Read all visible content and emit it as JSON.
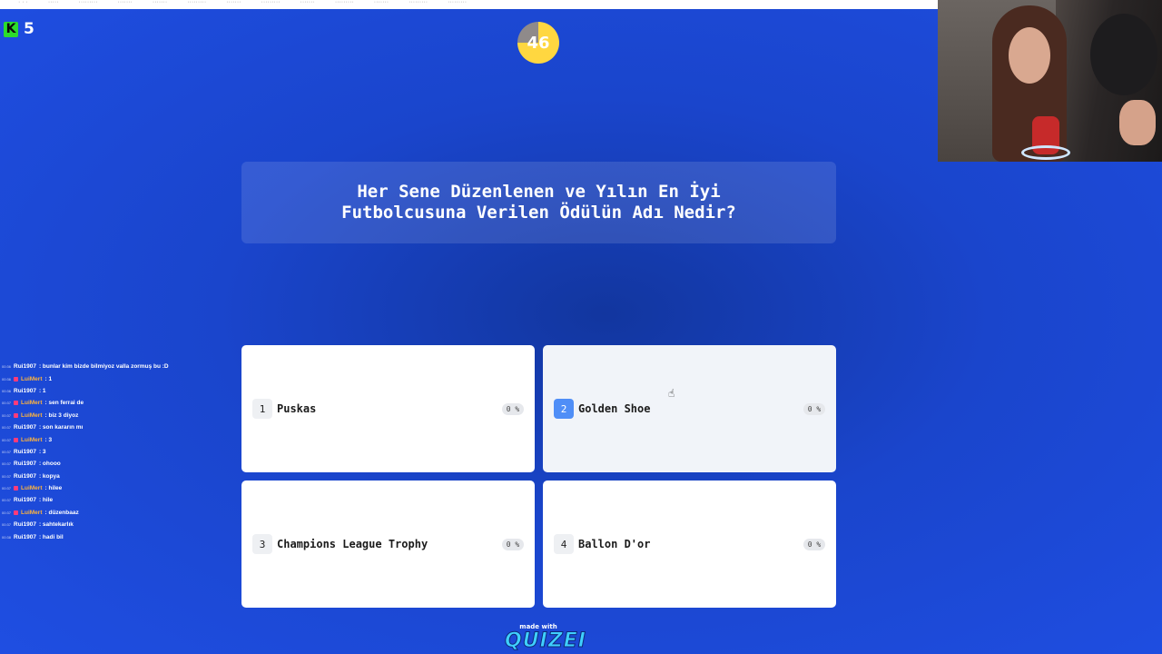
{
  "browser": {
    "bookmarks": [
      "· · ·",
      "·····",
      "·········",
      "·······",
      "·······",
      "·········",
      "·······",
      "·········",
      "·······",
      "·········",
      "·······",
      "·········",
      "·········"
    ]
  },
  "kick": {
    "viewer_count": "5",
    "logo": "K"
  },
  "timer": {
    "seconds_left": "46",
    "remaining_fraction": 0.75
  },
  "question": {
    "text": "Her Sene Düzenlenen ve Yılın En İyi Futbolcusuna Verilen Ödülün Adı Nedir?"
  },
  "answers": [
    {
      "number": "1",
      "label": "Puskas",
      "percent": "0 %"
    },
    {
      "number": "2",
      "label": "Golden Shoe",
      "percent": "0 %"
    },
    {
      "number": "3",
      "label": "Champions League Trophy",
      "percent": "0 %"
    },
    {
      "number": "4",
      "label": "Ballon D'or",
      "percent": "0 %"
    }
  ],
  "chat": [
    {
      "time": "00:36",
      "user": "Rui1907",
      "message": ": bunlar kim bizde bilmiyoz valla zormuş bu :D",
      "highlight": false
    },
    {
      "time": "00:36",
      "user": "LuiMert",
      "message": ": 1",
      "highlight": true
    },
    {
      "time": "00:36",
      "user": "Rui1907",
      "message": ": 1",
      "highlight": false
    },
    {
      "time": "00:37",
      "user": "LuiMert",
      "message": ": sen ferrai de",
      "highlight": true
    },
    {
      "time": "00:37",
      "user": "LuiMert",
      "message": ": biz 3 diyoz",
      "highlight": true
    },
    {
      "time": "00:37",
      "user": "Rui1907",
      "message": ": son kararın mı",
      "highlight": false
    },
    {
      "time": "00:37",
      "user": "LuiMert",
      "message": ": 3",
      "highlight": true
    },
    {
      "time": "00:37",
      "user": "Rui1907",
      "message": ": 3",
      "highlight": false
    },
    {
      "time": "00:37",
      "user": "Rui1907",
      "message": ": ohooo",
      "highlight": false
    },
    {
      "time": "00:37",
      "user": "Rui1907",
      "message": ": kopya",
      "highlight": false
    },
    {
      "time": "00:37",
      "user": "LuiMert",
      "message": ": hilee",
      "highlight": true
    },
    {
      "time": "00:37",
      "user": "Rui1907",
      "message": ": hile",
      "highlight": false
    },
    {
      "time": "00:37",
      "user": "LuiMert",
      "message": ": düzenbaaz",
      "highlight": true
    },
    {
      "time": "00:37",
      "user": "Rui1907",
      "message": ": sahtekarlık",
      "highlight": false
    },
    {
      "time": "00:38",
      "user": "Rui1907",
      "message": ": hadi bil",
      "highlight": false
    }
  ],
  "footer": {
    "made_with": "made with",
    "brand": "QUIZEI"
  },
  "colors": {
    "background": "#1a45cc",
    "timer_fill": "#ffd740",
    "selected_number": "#4f8ef7",
    "chat_highlight_user": "#ffb43c",
    "kick_green": "#2cdc2c"
  }
}
